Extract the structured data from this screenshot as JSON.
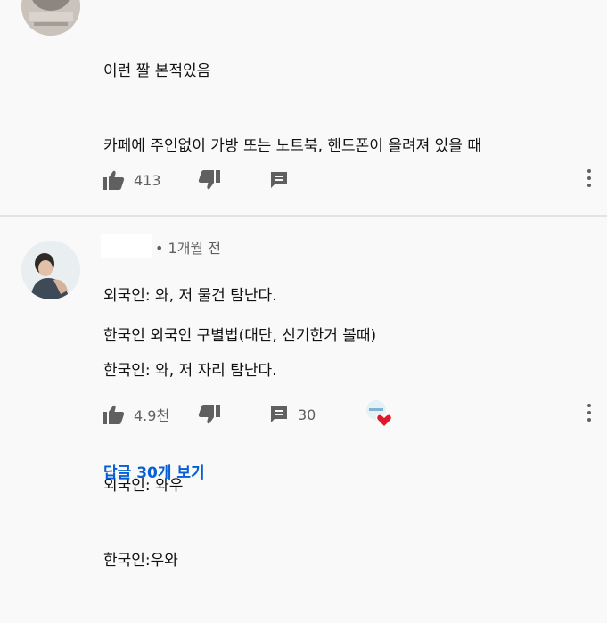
{
  "comments": [
    {
      "lines": [
        "이런 짤 본적있음",
        "카페에 주인없이 가방 또는 노트북, 핸드폰이 올려져 있을 때",
        "",
        "외국인: 와, 저 물건 탐난다.",
        "한국인: 와, 저 자리 탐난다."
      ],
      "like_count": "413"
    },
    {
      "time_ago": "• 1개월 전",
      "lines": [
        "한국인 외국인 구별법(대단, 신기한거 볼때)",
        "",
        "외국인: 와우",
        "한국인:우와"
      ],
      "like_count": "4.9천",
      "reply_count": "30",
      "view_replies_label": "답글 30개 보기"
    }
  ],
  "icons": [
    "like-icon",
    "dislike-icon",
    "reply-icon",
    "more-options-icon",
    "creator-heart-icon"
  ],
  "colors": {
    "link": "#065fd4",
    "icon": "#606060",
    "heart": "#e0182c"
  }
}
